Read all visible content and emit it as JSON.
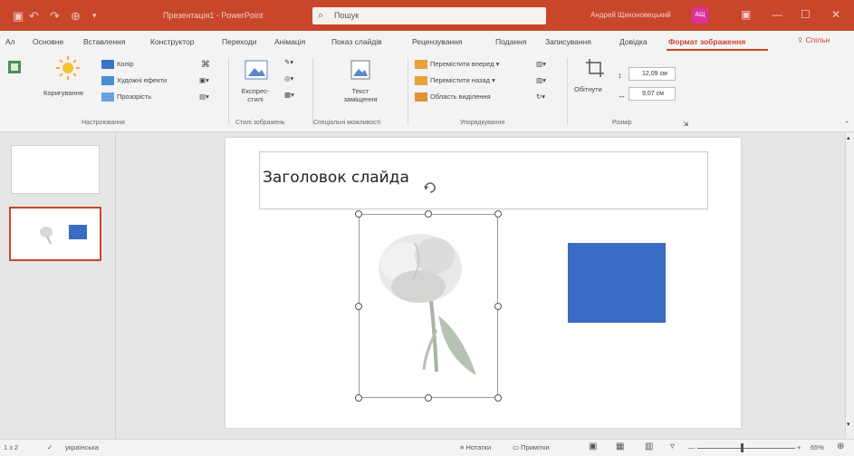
{
  "titlebar": {
    "title": "Презентація1 - PowerPoint",
    "search_placeholder": "Пошук",
    "user_name": "Андрей Щиконовецький",
    "avatar_initials": "АЩ",
    "accent": "#c8462a"
  },
  "tabs": [
    {
      "label": "Ал"
    },
    {
      "label": "Основне"
    },
    {
      "label": "Вставлення"
    },
    {
      "label": "Конструктор"
    },
    {
      "label": "Переходи"
    },
    {
      "label": "Анімація"
    },
    {
      "label": "Показ слайдів"
    },
    {
      "label": "Рецензування"
    },
    {
      "label": "Подання"
    },
    {
      "label": "Записування"
    },
    {
      "label": "Довідка"
    },
    {
      "label": "Формат зображення"
    }
  ],
  "share_label": "Спільн",
  "ribbon": {
    "corrections": "Коригування",
    "color": "Колір",
    "artistic_effects": "Художні ефекти",
    "transparency": "Прозорість",
    "group_adjust": "Настроювання",
    "express_styles": "Експрес-стилі",
    "group_styles": "Стилі зображень",
    "group_accessibility": "Спеціальні можливості",
    "alt_text": "Текст заміщення",
    "bring_forward": "Перемістити вперед",
    "send_backward": "Перемістити назад",
    "selection_pane": "Область виділення",
    "group_arrange": "Упорядкування",
    "crop": "Обітнути",
    "height": "12,09 см",
    "width": "9,07 см",
    "group_size": "Розмір"
  },
  "slide": {
    "title": "Заголовок слайда",
    "shape_color": "#3a6bc5"
  },
  "status": {
    "slide_info": "1 з 2",
    "language": "українська",
    "notes": "Нотатки",
    "comments": "Примітки",
    "zoom": "65%"
  }
}
